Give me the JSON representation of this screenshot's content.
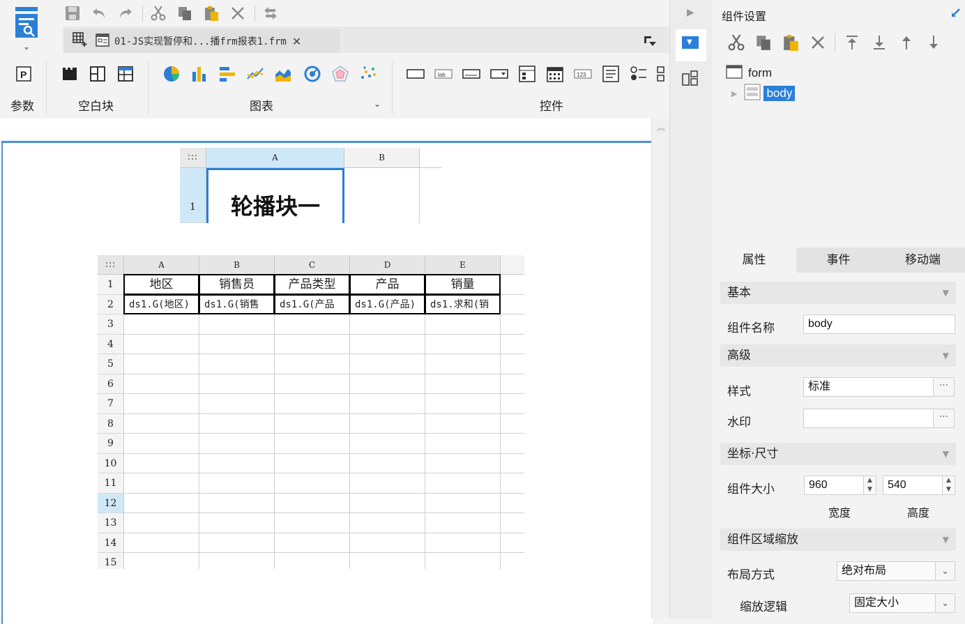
{
  "file_tab": {
    "title": "01-JS实现暂停和...播frm报表1.frm"
  },
  "ribbon": {
    "param_label": "参数",
    "blank_label": "空白块",
    "chart_label": "图表",
    "control_label": "控件"
  },
  "top_sheet": {
    "col_a": "A",
    "col_b": "B",
    "row_1": "1",
    "title_text": "轮播块一"
  },
  "main_sheet": {
    "columns": [
      "A",
      "B",
      "C",
      "D",
      "E"
    ],
    "rows": [
      "1",
      "2",
      "3",
      "4",
      "5",
      "6",
      "7",
      "8",
      "9",
      "10",
      "11",
      "12",
      "13",
      "14",
      "15"
    ],
    "headers": [
      "地区",
      "销售员",
      "产品类型",
      "产品",
      "销量"
    ],
    "formulas": [
      "ds1.G(地区)",
      "ds1.G(销售",
      "ds1.G(产品",
      "ds1.G(产品)",
      "ds1.求和(销"
    ],
    "selected_row": "12"
  },
  "panel": {
    "title": "组件设置",
    "tree": {
      "root": "form",
      "child": "body"
    },
    "tabs": [
      "属性",
      "事件",
      "移动端"
    ],
    "sections": {
      "basic": "基本",
      "advanced": "高级",
      "coord": "坐标·尺寸",
      "zoom": "组件区域缩放"
    },
    "fields": {
      "name_label": "组件名称",
      "name_value": "body",
      "style_label": "样式",
      "style_value": "标准",
      "watermark_label": "水印",
      "watermark_value": "",
      "size_label": "组件大小",
      "width_value": "960",
      "height_value": "540",
      "width_label": "宽度",
      "height_label": "高度",
      "layout_label": "布局方式",
      "layout_value": "绝对布局",
      "scale_label": "缩放逻辑",
      "scale_value": "固定大小"
    },
    "ellipsis": "···"
  },
  "colors": {
    "accent": "#2b7fd6",
    "selection": "#4a90d9",
    "header_highlight": "#cfe8f7"
  }
}
